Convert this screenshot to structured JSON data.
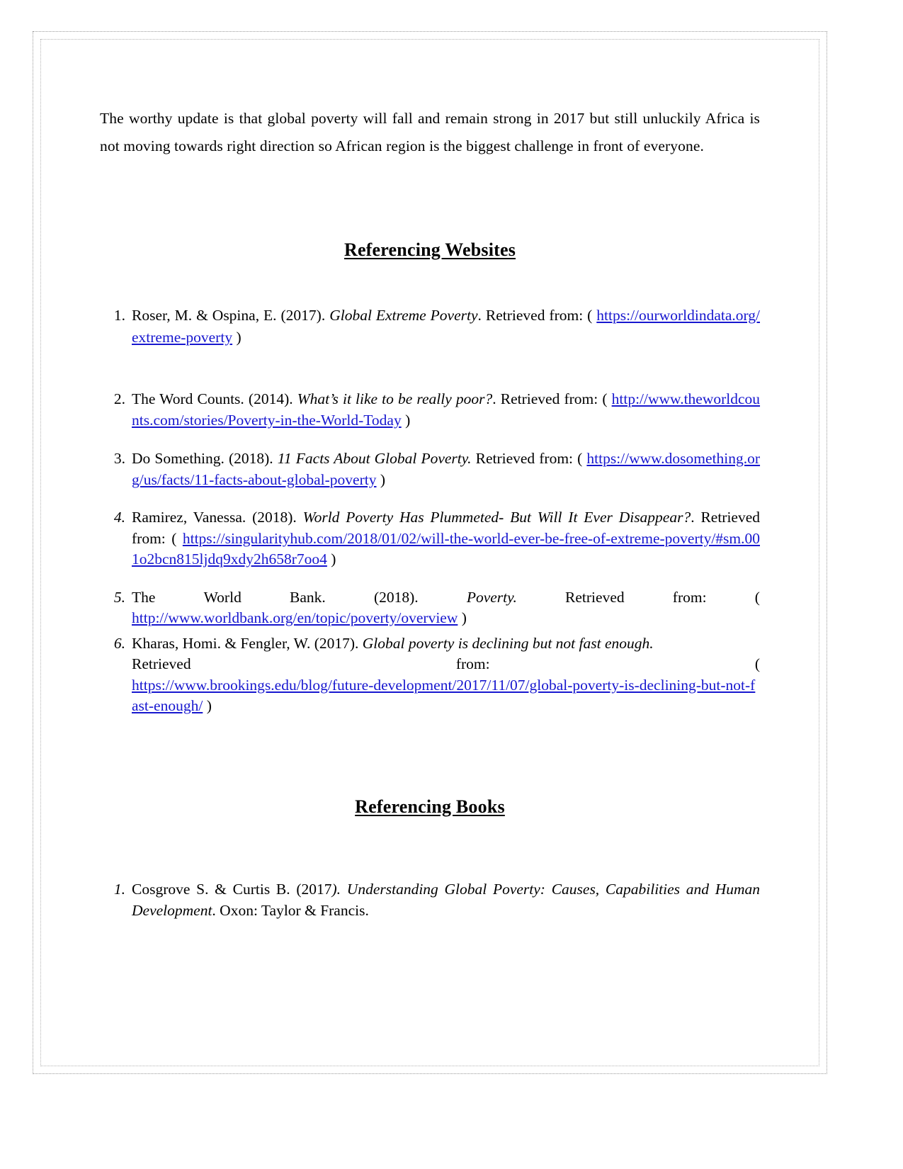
{
  "document": {
    "intro_paragraph": "The worthy update is that global poverty will fall and remain strong in 2017 but still unluckily Africa is not moving towards right direction so African region is the biggest challenge in front of everyone.",
    "sections": [
      {
        "heading": "Referencing Websites",
        "items": [
          {
            "number": "1.",
            "number_italic": false,
            "author": "Roser, M. & Ospina, E. (2017).",
            "title": "Global Extreme Poverty",
            "retrieved_label": "Retrieved from:",
            "paren_open": "(",
            "url": "https://ourworldindata.org/extreme-poverty",
            "paren_close": ")",
            "title_trailing": "."
          },
          {
            "number": "2.",
            "number_italic": false,
            "author": "The Word Counts. (2014).",
            "title": "What’s it like to be really poor?",
            "retrieved_label": "Retrieved from:",
            "paren_open": "(",
            "url": "http://www.theworldcounts.com/stories/Poverty-in-the-World-Today",
            "paren_close": ")",
            "title_trailing": "."
          },
          {
            "number": "3.",
            "number_italic": false,
            "author": "Do Something. (2018).",
            "title": "11 Facts About Global Poverty.",
            "retrieved_label": "Retrieved from:",
            "paren_open": "(",
            "url": "https://www.dosomething.org/us/facts/11-facts-about-global-poverty",
            "paren_close": ")",
            "title_trailing": ""
          },
          {
            "number": "4.",
            "number_italic": true,
            "author": "Ramirez, Vanessa. (2018).",
            "title": "World Poverty Has Plummeted- But Will It Ever Disappear?",
            "retrieved_label": "Retrieved from:",
            "paren_open": "(",
            "url": "https://singularityhub.com/2018/01/02/will-the-world-ever-be-free-of-extreme-poverty/#sm.001o2bcn815ljdq9xdy2h658r7oo4",
            "paren_close": ")",
            "title_trailing": "."
          },
          {
            "number": "5.",
            "number_italic": true,
            "author": "The World Bank. (2018).",
            "title": "Poverty.",
            "retrieved_label": "Retrieved from:",
            "paren_open": "(",
            "url": "http://www.worldbank.org/en/topic/poverty/overview",
            "paren_close": ")",
            "title_trailing": ""
          },
          {
            "number": "6.",
            "number_italic": true,
            "author": "Kharas, Homi. & Fengler, W. (2017).",
            "title": "Global poverty is declining but not fast enough.",
            "retrieved_label": "Retrieved from:",
            "retrieved_word": "Retrieved",
            "from_word": "from:",
            "paren_open": "(",
            "url": "https://www.brookings.edu/blog/future-development/2017/11/07/global-poverty-is-declining-but-not-fast-enough/",
            "paren_close": ")",
            "title_trailing": ""
          }
        ]
      },
      {
        "heading": "Referencing Books",
        "items": [
          {
            "number": "1.",
            "number_italic": true,
            "author": "Cosgrove S. & Curtis B. (2017",
            "author_tail": ").",
            "title": "Understanding Global Poverty: Causes, Capabilities and Human Development",
            "publisher": ". Oxon: Taylor & Francis."
          }
        ]
      }
    ]
  }
}
